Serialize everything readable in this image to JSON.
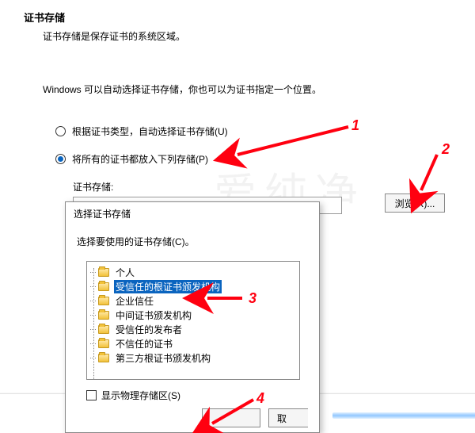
{
  "wizard": {
    "title": "证书存储",
    "subtitle": "证书存储是保存证书的系统区域。",
    "hint": "Windows 可以自动选择证书存储，你也可以为证书指定一个位置。",
    "radio_auto": "根据证书类型，自动选择证书存储(U)",
    "radio_manual": "将所有的证书都放入下列存储(P)",
    "store_label": "证书存储:",
    "browse_label": "浏览(R)..."
  },
  "dialog": {
    "title": "选择证书存储",
    "hint": "选择要使用的证书存储(C)。",
    "tree": [
      "个人",
      "受信任的根证书颁发机构",
      "企业信任",
      "中间证书颁发机构",
      "受信任的发布者",
      "不信任的证书",
      "第三方根证书颁发机构"
    ],
    "selected_index": 1,
    "show_physical": "显示物理存储区(S)",
    "cancel_partial": "取"
  },
  "annotations": {
    "n1": "1",
    "n2": "2",
    "n3": "3",
    "n4": "4",
    "watermark": "爱纯净"
  },
  "colors": {
    "accent": "#0a64bf",
    "anno": "#ff0010"
  }
}
